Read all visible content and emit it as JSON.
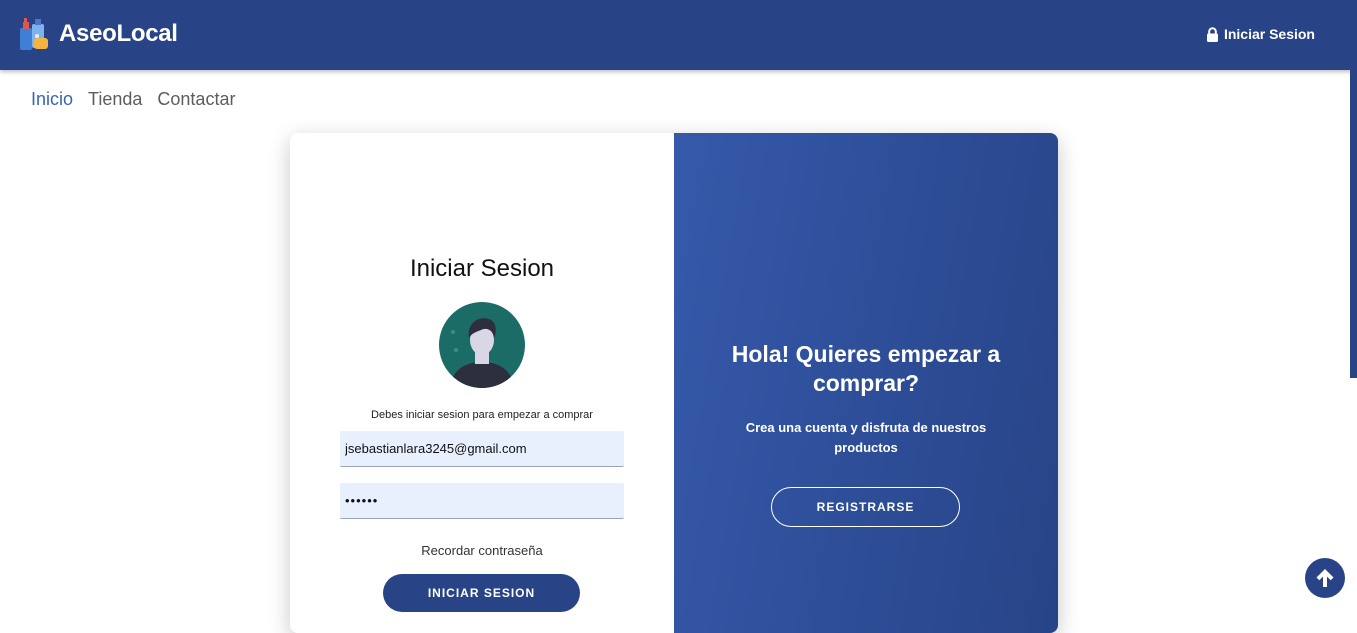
{
  "header": {
    "brand": "AseoLocal",
    "logo_icon": "cleaning-products-icon",
    "login_link": "Iniciar Sesion",
    "login_icon": "lock-icon",
    "bg_color": "#284487"
  },
  "nav": {
    "items": [
      {
        "label": "Inicio",
        "active": true
      },
      {
        "label": "Tienda",
        "active": false
      },
      {
        "label": "Contactar",
        "active": false
      }
    ],
    "active_color": "#3a63b8"
  },
  "login": {
    "title": "Iniciar Sesion",
    "avatar_icon": "user-avatar-icon",
    "hint": "Debes iniciar sesion para empezar a comprar",
    "email_value": "jsebastianlara3245@gmail.com",
    "password_value": "••••••",
    "remember": "Recordar contraseña",
    "submit": "INICIAR SESION"
  },
  "promo": {
    "title": "Hola! Quieres empezar a comprar?",
    "text": "Crea una cuenta y disfruta de nuestros productos",
    "register": "REGISTRARSE"
  },
  "scroll_top": {
    "icon": "arrow-up-icon"
  }
}
